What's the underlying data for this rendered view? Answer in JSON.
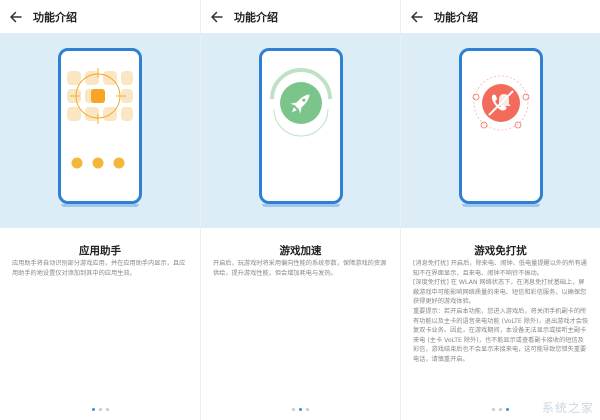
{
  "screens": [
    {
      "nav_title": "功能介绍",
      "heading": "应用助手",
      "description": [
        "应用助手将自动识别部分游戏应用，并在应用助手内显示，且应用助手的地设置仅对添加到其中的应用生效。"
      ],
      "active_dot": 0
    },
    {
      "nav_title": "功能介绍",
      "heading": "游戏加速",
      "description": [
        "开启后，玩游戏时将采用偏向性能的系统参数，保障游戏的资源供给，提升游戏性能，但会增加耗电与发热。"
      ],
      "active_dot": 1
    },
    {
      "nav_title": "功能介绍",
      "heading": "游戏免打扰",
      "description": [
        "[消息免打扰] 开启后，除来电、闹钟、低电量提醒以外的所有通知不在界面显示，且来电、闹钟不响铃不振动。",
        "[深度免打扰] 在 WLAN 网络状态下，在消息免打扰基础上，屏蔽游戏中可能影响网络质量的来电、短信和彩信服务，以确保您获得更好的游戏体验。",
        "重要提示：若开启本功能，您进入游戏后，将关闭手机副卡的所有功能以及主卡的语音来电功能 (VoLTE 除外)，退出游戏才会恢复双卡业务。因此，在游戏期间，本设备无法显示或接听主副卡来电 (主卡 VoLTE 除外)，也不能显示或查看副卡接收的短信及彩信，游戏结束后也不会显示未接来电，这可能导致您错失重要电话，请慎重开启。"
      ],
      "active_dot": 2
    }
  ],
  "watermark": "系统之家",
  "colors": {
    "hero_bg": "#dcedf8",
    "phone_frame": "#2f7fd3",
    "accent_orange": "#f5a623",
    "accent_green": "#7cc58a",
    "accent_red": "#f26b5b",
    "dot_active": "#3d8ee0",
    "dot_inactive": "#c9c9c9"
  }
}
